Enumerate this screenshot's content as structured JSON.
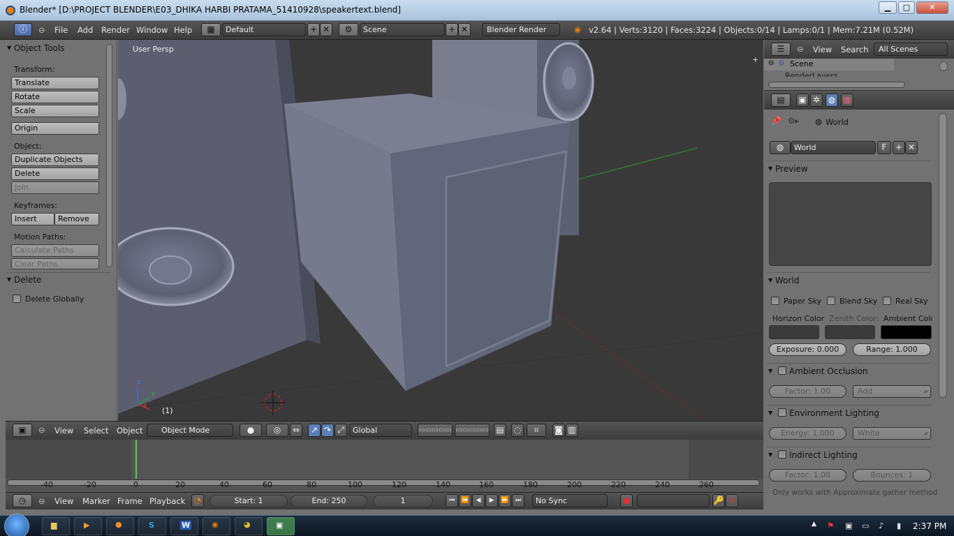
{
  "window": {
    "title": "Blender* [D:\\PROJECT BLENDER\\E03_DHIKA HARBI PRATAMA_51410928\\speakertext.blend]",
    "minimize": "▁",
    "maximize": "□",
    "close": "✕"
  },
  "menubar": {
    "menus": [
      "File",
      "Add",
      "Render",
      "Window",
      "Help"
    ],
    "layout": "Default",
    "scene": "Scene",
    "engine": "Blender Render",
    "stats": "v2.64 | Verts:3120 | Faces:3224 | Objects:0/14 | Lamps:0/1 | Mem:7.21M (0.52M)"
  },
  "toolshelf": {
    "title": "Object Tools",
    "transform_label": "Transform:",
    "translate": "Translate",
    "rotate": "Rotate",
    "scale": "Scale",
    "origin": "Origin",
    "object_label": "Object:",
    "duplicate": "Duplicate Objects",
    "delete": "Delete",
    "join": "Join",
    "keyframes_label": "Keyframes:",
    "insert": "Insert",
    "remove": "Remove",
    "motion_label": "Motion Paths:",
    "calc_paths": "Calculate Paths",
    "clear_paths": "Clear Paths",
    "delete_panel": "Delete",
    "delete_globally": "Delete Globally"
  },
  "viewport": {
    "view_name": "User Persp",
    "frame": "(1)",
    "axis_x": "x",
    "axis_y": "y",
    "axis_z": "z"
  },
  "vp_header": {
    "view": "View",
    "select": "Select",
    "object": "Object",
    "mode": "Object Mode",
    "orientation": "Global"
  },
  "timeline": {
    "ticks": [
      "-40",
      "-20",
      "0",
      "20",
      "40",
      "60",
      "80",
      "100",
      "120",
      "140",
      "160",
      "180",
      "200",
      "220",
      "240",
      "260"
    ],
    "current": 0
  },
  "tl_header": {
    "view": "View",
    "marker": "Marker",
    "frame": "Frame",
    "playback": "Playback",
    "start": "Start: 1",
    "end": "End: 250",
    "current": "1",
    "sync": "No Sync"
  },
  "outliner": {
    "view": "View",
    "search": "Search",
    "filter": "All Scenes",
    "scene": "Scene",
    "sub": "RenderLayers"
  },
  "props": {
    "breadcrumb": "World",
    "world_name": "World",
    "fake": "F",
    "preview": "Preview",
    "world_panel": "World",
    "paper_sky": "Paper Sky",
    "blend_sky": "Blend Sky",
    "real_sky": "Real Sky",
    "horizon": "Horizon Color",
    "zenith": "Zenith Color:",
    "ambient": "Ambient Colo",
    "exposure": "Exposure: 0.000",
    "range": "Range: 1.000",
    "ao": "Ambient Occlusion",
    "ao_factor": "Factor: 1.00",
    "ao_mode": "Add",
    "env": "Environment Lighting",
    "energy": "Energy: 1.000",
    "env_color": "White",
    "indirect": "Indirect Lighting",
    "ind_factor": "Factor: 1.00",
    "bounces": "Bounces: 1",
    "note": "Only works with Approximate gather method"
  },
  "colors": {
    "horizon": "#3a3a3a",
    "zenith": "#3a3a3a",
    "ambient": "#000000"
  },
  "taskbar": {
    "clock": "2:37 PM"
  }
}
